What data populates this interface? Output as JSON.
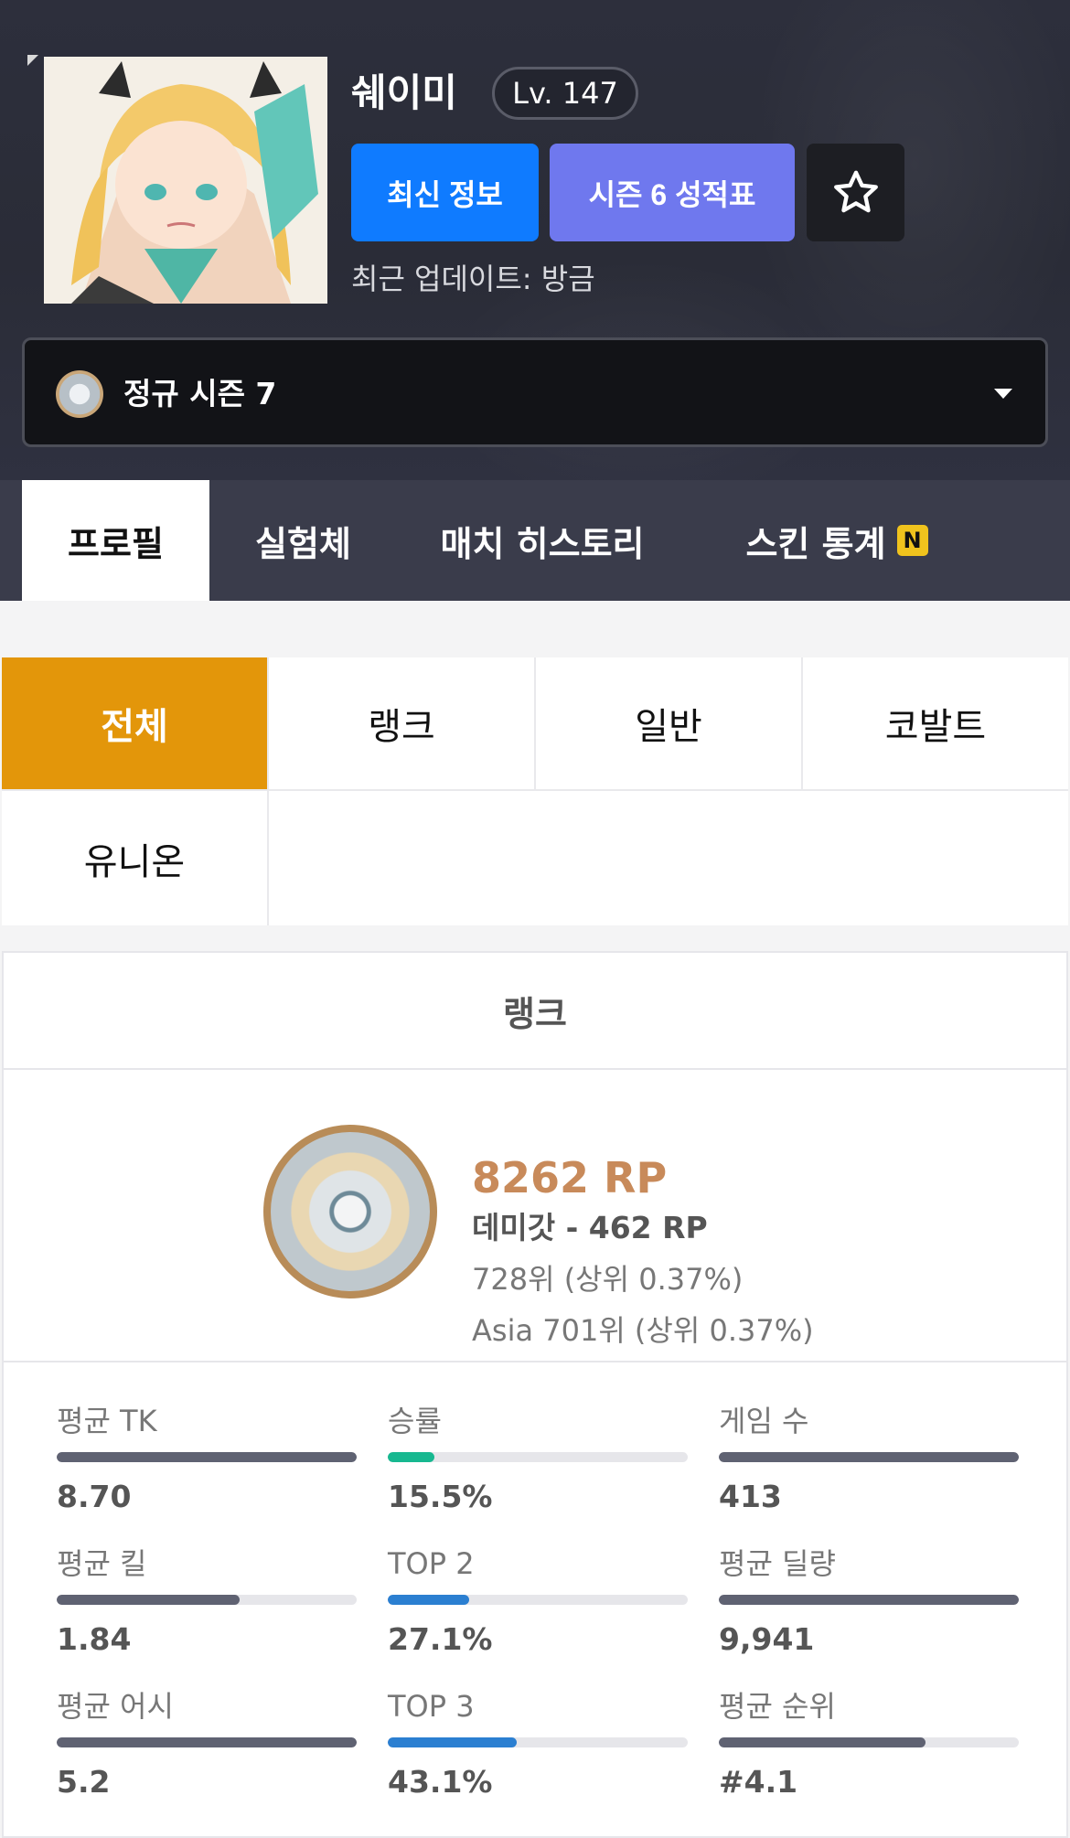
{
  "profile": {
    "nickname": "쉐이미",
    "level": "Lv. 147",
    "updated": "최근 업데이트: 방금"
  },
  "buttons": {
    "latest_info": "최신 정보",
    "season_record": "시즌 6 성적표",
    "favorite_icon": "star-icon"
  },
  "season_select": {
    "selected": "정규 시즌 7"
  },
  "nav_tabs": [
    {
      "label": "프로필",
      "active": true
    },
    {
      "label": "실험체",
      "active": false
    },
    {
      "label": "매치 히스토리",
      "active": false
    },
    {
      "label": "스킨 통계",
      "active": false,
      "badge": "N"
    }
  ],
  "modes": [
    {
      "label": "전체",
      "active": true
    },
    {
      "label": "랭크",
      "active": false
    },
    {
      "label": "일반",
      "active": false
    },
    {
      "label": "코발트",
      "active": false
    },
    {
      "label": "유니온",
      "active": false
    }
  ],
  "rank_card": {
    "title": "랭크",
    "rp": "8262 RP",
    "tier": "데미갓 - 462 RP",
    "rank": "728위 (상위 0.37%)",
    "region_rank": "Asia 701위 (상위 0.37%)"
  },
  "stats": [
    {
      "label": "평균 TK",
      "value": "8.70",
      "fill": 1.0,
      "color": "#5f6272"
    },
    {
      "label": "승률",
      "value": "15.5%",
      "fill": 0.155,
      "color": "#17b890"
    },
    {
      "label": "게임 수",
      "value": "413",
      "fill": 1.0,
      "color": "#5f6272"
    },
    {
      "label": "평균 킬",
      "value": "1.84",
      "fill": 0.61,
      "color": "#5f6272"
    },
    {
      "label": "TOP 2",
      "value": "27.1%",
      "fill": 0.271,
      "color": "#2b7fd1"
    },
    {
      "label": "평균 딜량",
      "value": "9,941",
      "fill": 1.0,
      "color": "#5f6272"
    },
    {
      "label": "평균 어시",
      "value": "5.2",
      "fill": 1.0,
      "color": "#5f6272"
    },
    {
      "label": "TOP 3",
      "value": "43.1%",
      "fill": 0.431,
      "color": "#2b7fd1"
    },
    {
      "label": "평균 순위",
      "value": "#4.1",
      "fill": 0.69,
      "color": "#5f6272"
    }
  ],
  "colors": {
    "accent_blue": "#0f7bff",
    "accent_purple": "#6f78ee",
    "mode_active": "#e3960a",
    "rp": "#c88a5a"
  }
}
